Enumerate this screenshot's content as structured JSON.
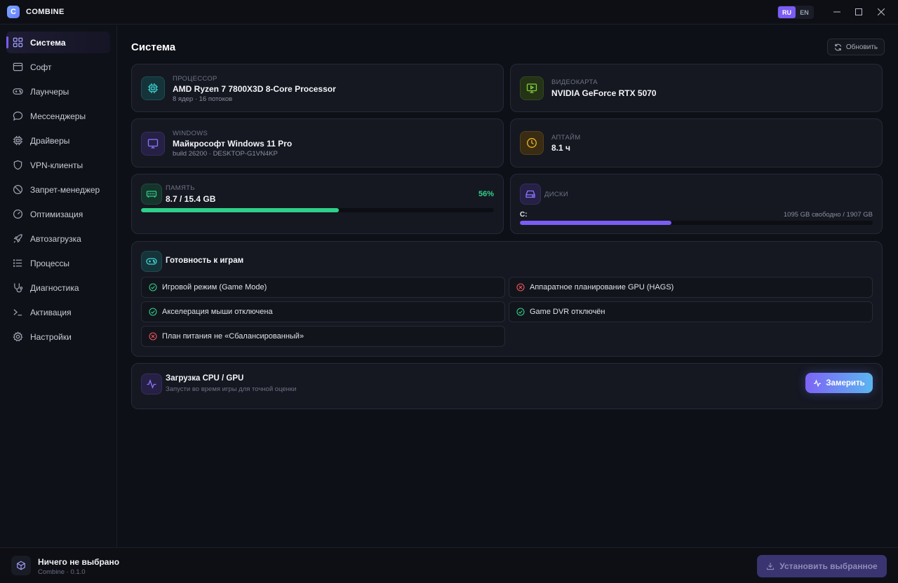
{
  "app": {
    "logo_letter": "C",
    "name": "COMBINE"
  },
  "lang": {
    "ru": "RU",
    "en": "EN",
    "active": "RU"
  },
  "window_controls": {
    "minimize": "—",
    "maximize": "☐",
    "close": "✕"
  },
  "sidebar": {
    "items": [
      {
        "label": "Система",
        "icon": "grid-icon",
        "active": true
      },
      {
        "label": "Софт",
        "icon": "window-icon",
        "active": false
      },
      {
        "label": "Лаунчеры",
        "icon": "gamepad-icon",
        "active": false
      },
      {
        "label": "Мессенджеры",
        "icon": "chat-icon",
        "active": false
      },
      {
        "label": "Драйверы",
        "icon": "chip-icon",
        "active": false
      },
      {
        "label": "VPN-клиенты",
        "icon": "shield-icon",
        "active": false
      },
      {
        "label": "Запрет-менеджер",
        "icon": "ban-icon",
        "active": false
      },
      {
        "label": "Оптимизация",
        "icon": "speedometer-icon",
        "active": false
      },
      {
        "label": "Автозагрузка",
        "icon": "rocket-icon",
        "active": false
      },
      {
        "label": "Процессы",
        "icon": "list-icon",
        "active": false
      },
      {
        "label": "Диагностика",
        "icon": "stethoscope-icon",
        "active": false
      },
      {
        "label": "Активация",
        "icon": "terminal-icon",
        "active": false
      },
      {
        "label": "Настройки",
        "icon": "gear-icon",
        "active": false
      }
    ]
  },
  "main": {
    "title": "Система",
    "refresh_label": "Обновить",
    "cpu": {
      "label": "ПРОЦЕССОР",
      "value": "AMD Ryzen 7 7800X3D 8-Core Processor",
      "sub": "8 ядер · 16 потоков"
    },
    "gpu": {
      "label": "ВИДЕОКАРТА",
      "value": "NVIDIA GeForce RTX 5070"
    },
    "os": {
      "label": "WINDOWS",
      "value": "Майкрософт Windows 11 Pro",
      "sub": "build 26200 · DESKTOP-G1VN4KP"
    },
    "uptime": {
      "label": "АПТАЙМ",
      "value": "8.1 ч"
    },
    "memory": {
      "label": "ПАМЯТЬ",
      "value": "8.7 / 15.4 GB",
      "percent_label": "56%",
      "fraction": 0.56
    },
    "disks": {
      "label": "ДИСКИ",
      "drive": "C:",
      "info": "1095 GB свободно / 1907 GB",
      "fraction": 0.43
    },
    "gaming": {
      "title": "Готовность к играм",
      "items": [
        {
          "text": "Игровой режим (Game Mode)",
          "ok": true
        },
        {
          "text": "Аппаратное планирование GPU (HAGS)",
          "ok": false
        },
        {
          "text": "Акселерация мыши отключена",
          "ok": true
        },
        {
          "text": "Game DVR отключён",
          "ok": true
        },
        {
          "text": "План питания не «Сбалансированный»",
          "ok": false
        }
      ]
    },
    "load": {
      "title": "Загрузка CPU / GPU",
      "sub": "Запусти во время игры для точной оценки",
      "button": "Замерить"
    }
  },
  "footer": {
    "title": "Ничего не выбрано",
    "sub": "Combine · 0.1.0",
    "install_label": "Установить выбранное"
  },
  "colors": {
    "accent": "#7b5cf5",
    "green": "#2fd08a",
    "red": "#f0545c",
    "purple": "#7b5cf5"
  }
}
